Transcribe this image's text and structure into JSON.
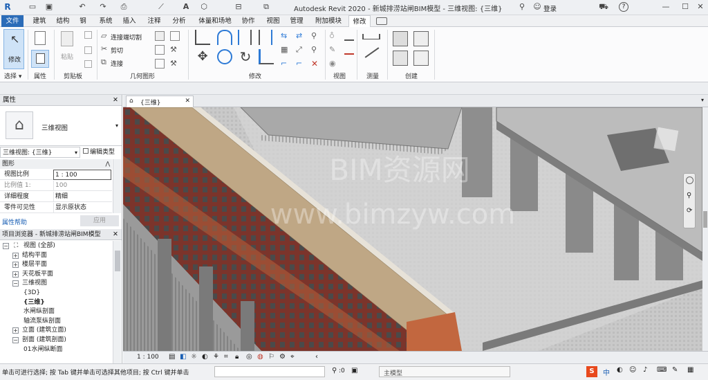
{
  "title_bar": {
    "app_title": "Autodesk Revit 2020 - 新城排涝站闸BIM模型 - 三维视图: {三维}",
    "login_label": "登录",
    "help_label": "?"
  },
  "ribbon_tabs": [
    "文件",
    "建筑",
    "结构",
    "钢",
    "系统",
    "插入",
    "注释",
    "分析",
    "体量和场地",
    "协作",
    "视图",
    "管理",
    "附加模块",
    "修改"
  ],
  "ribbon": {
    "select": {
      "modify_label": "修改",
      "panel_label": "选择 ▾"
    },
    "properties": {
      "panel_label": "属性"
    },
    "clipboard": {
      "paste_label": "粘贴",
      "panel_label": "剪贴板"
    },
    "geometry": {
      "cut_join_label": "连接端切割",
      "cut_label": "剪切",
      "join_label": "连接",
      "panel_label": "几何图形"
    },
    "modify": {
      "panel_label": "修改"
    },
    "view": {
      "panel_label": "视图"
    },
    "measure": {
      "panel_label": "测量"
    },
    "create": {
      "panel_label": "创建"
    }
  },
  "properties_panel": {
    "title": "属性",
    "type_name": "三维视图",
    "selector_value": "三维视图: {三维}",
    "edit_type_label": "编辑类型",
    "section_label": "图形",
    "rows": [
      {
        "key": "视图比例",
        "value": "1 : 100"
      },
      {
        "key": "比例值 1:",
        "value": "100"
      },
      {
        "key": "详细程度",
        "value": "精细"
      },
      {
        "key": "零件可见性",
        "value": "显示原状态"
      }
    ],
    "help_link": "属性帮助",
    "apply_label": "应用"
  },
  "project_browser": {
    "title": "项目浏览器 - 新城排涝站闸BIM模型",
    "items": [
      {
        "label": "视图 (全部)",
        "expander": "−"
      },
      {
        "label": "结构平面",
        "expander": "+"
      },
      {
        "label": "楼层平面",
        "expander": "+"
      },
      {
        "label": "天花板平面",
        "expander": "+"
      },
      {
        "label": "三维视图",
        "expander": "−"
      },
      {
        "label": "{3D}",
        "expander": ""
      },
      {
        "label": "{三维}",
        "expander": ""
      },
      {
        "label": "水闸纵剖面",
        "expander": ""
      },
      {
        "label": "轴流泵纵剖面",
        "expander": ""
      },
      {
        "label": "立面 (建筑立面)",
        "expander": "+"
      },
      {
        "label": "剖面 (建筑剖面)",
        "expander": "−"
      },
      {
        "label": "01水闸纵断面",
        "expander": ""
      }
    ]
  },
  "view_tab": {
    "label": "{三维}"
  },
  "view_control_bar": {
    "scale": "1 : 100"
  },
  "watermark": {
    "line1": "BIM资源网",
    "line2": "www.bimzyw.com"
  },
  "status_bar": {
    "message": "单击可进行选择; 按 Tab 键并单击可选择其他项目; 按 Ctrl 键并单击",
    "zero": ":0",
    "model_label": "主模型",
    "ime_label": "中"
  },
  "colors": {
    "file_tab": "#2b6cb8",
    "roof": "#bfa785",
    "wall": "#8a3a30",
    "concrete": "#9c9c9c"
  }
}
